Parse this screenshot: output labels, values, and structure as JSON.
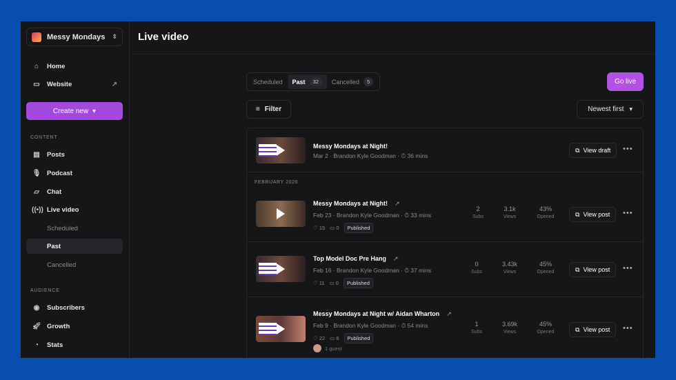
{
  "sidebar": {
    "publication": "Messy Mondays",
    "home": "Home",
    "website": "Website",
    "create_new": "Create new",
    "content_label": "CONTENT",
    "posts": "Posts",
    "podcast": "Podcast",
    "chat": "Chat",
    "live_video": "Live video",
    "scheduled": "Scheduled",
    "past": "Past",
    "cancelled": "Cancelled",
    "audience_label": "AUDIENCE",
    "subscribers": "Subscribers",
    "growth": "Growth",
    "stats": "Stats"
  },
  "header": {
    "title": "Live video"
  },
  "tabs": [
    {
      "label": "Scheduled"
    },
    {
      "label": "Past",
      "count": "32"
    },
    {
      "label": "Cancelled",
      "count": "5"
    }
  ],
  "go_live": "Go live",
  "filter": "Filter",
  "sort": "Newest first",
  "colors": {
    "accent": "#b251e4",
    "background": "#0a4db0"
  },
  "draft": {
    "title": "Messy Mondays at Night!",
    "meta": "Mar 2 · Brandon Kyle Goodman · ⏱ 36 mins",
    "action": "View draft"
  },
  "month": "FEBRUARY 2026",
  "posts": [
    {
      "title": "Messy Mondays at Night!",
      "meta": "Feb 23 · Brandon Kyle Goodman · ⏱ 33 mins",
      "likes": "15",
      "comments": "0",
      "status": "Published",
      "subs": "2",
      "subs_label": "Subs",
      "views": "3.1k",
      "views_label": "Views",
      "opened": "43%",
      "opened_label": "Opened",
      "action": "View post"
    },
    {
      "title": "Top Model Doc Pre Hang",
      "meta": "Feb 16 · Brandon Kyle Goodman · ⏱ 37 mins",
      "likes": "11",
      "comments": "0",
      "status": "Published",
      "subs": "0",
      "subs_label": "Subs",
      "views": "3.43k",
      "views_label": "Views",
      "opened": "45%",
      "opened_label": "Opened",
      "action": "View post"
    },
    {
      "title": "Messy Mondays at Night w/ Aidan Wharton",
      "meta": "Feb 9 · Brandon Kyle Goodman · ⏱ 54 mins",
      "likes": "22",
      "comments": "6",
      "status": "Published",
      "subs": "1",
      "subs_label": "Subs",
      "views": "3.69k",
      "views_label": "Views",
      "opened": "45%",
      "opened_label": "Opened",
      "action": "View post",
      "guests": "1 guest"
    }
  ]
}
